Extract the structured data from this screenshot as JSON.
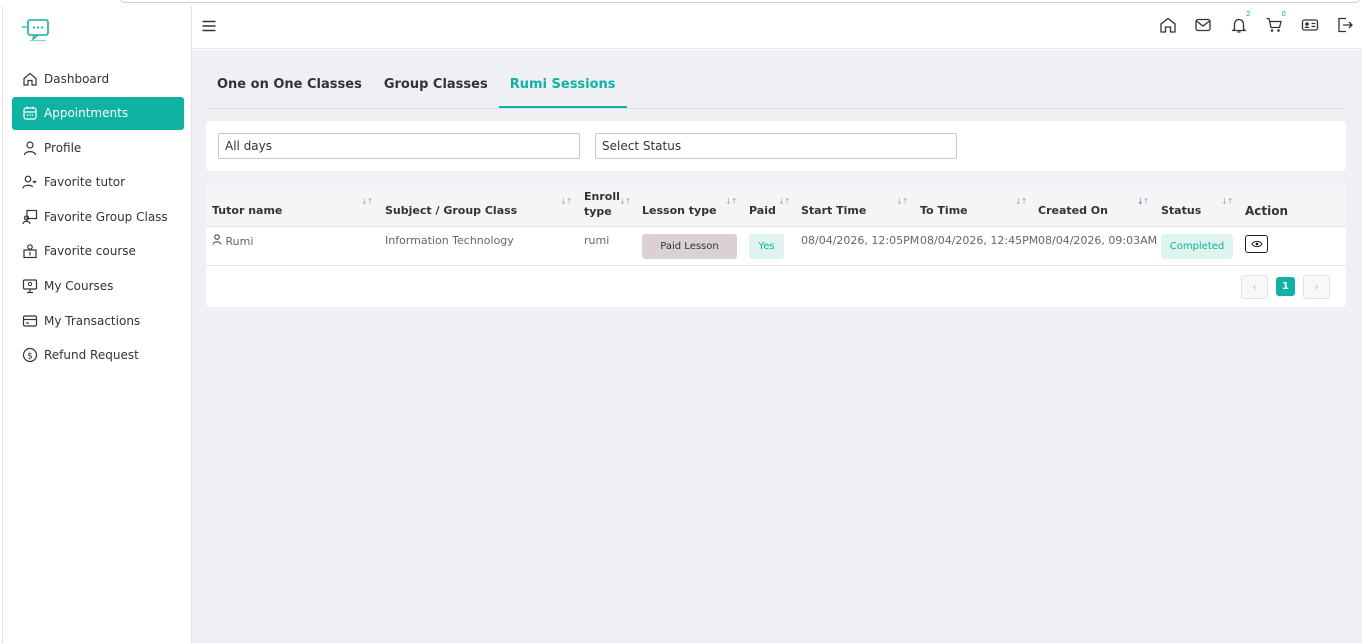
{
  "sidebar": {
    "items": [
      {
        "label": "Dashboard",
        "icon": "home-icon"
      },
      {
        "label": "Appointments",
        "icon": "calendar-icon",
        "active": true
      },
      {
        "label": "Profile",
        "icon": "user-icon"
      },
      {
        "label": "Favorite tutor",
        "icon": "user-heart-icon"
      },
      {
        "label": "Favorite Group Class",
        "icon": "group-class-icon"
      },
      {
        "label": "Favorite course",
        "icon": "course-icon"
      },
      {
        "label": "My Courses",
        "icon": "monitor-icon"
      },
      {
        "label": "My Transactions",
        "icon": "card-icon"
      },
      {
        "label": "Refund Request",
        "icon": "dollar-circle-icon"
      }
    ]
  },
  "header": {
    "notifications_count": "2",
    "cart_count": "0"
  },
  "tabs": [
    {
      "label": "One on One Classes"
    },
    {
      "label": "Group Classes"
    },
    {
      "label": "Rumi Sessions",
      "active": true
    }
  ],
  "filters": {
    "days": "All days",
    "status": "Select Status"
  },
  "table": {
    "headers": {
      "tutor": "Tutor name",
      "subject": "Subject / Group Class",
      "enroll_1": "Enroll",
      "enroll_2": "type",
      "lesson": "Lesson type",
      "paid": "Paid",
      "start": "Start Time",
      "to": "To Time",
      "created": "Created On",
      "status": "Status",
      "action": "Action"
    },
    "rows": [
      {
        "tutor": "Rumi",
        "subject": "Information Technology",
        "enroll": "rumi",
        "lesson": "Paid Lesson",
        "paid": "Yes",
        "start": "08/04/2026, 12:05PM",
        "to": "08/04/2026, 12:45PM",
        "created": "08/04/2026, 09:03AM",
        "status": "Completed"
      }
    ]
  },
  "pagination": {
    "prev": "‹",
    "current": "1",
    "next": "›"
  },
  "colors": {
    "accent": "#0fb2a3",
    "background": "#eef0f3"
  }
}
